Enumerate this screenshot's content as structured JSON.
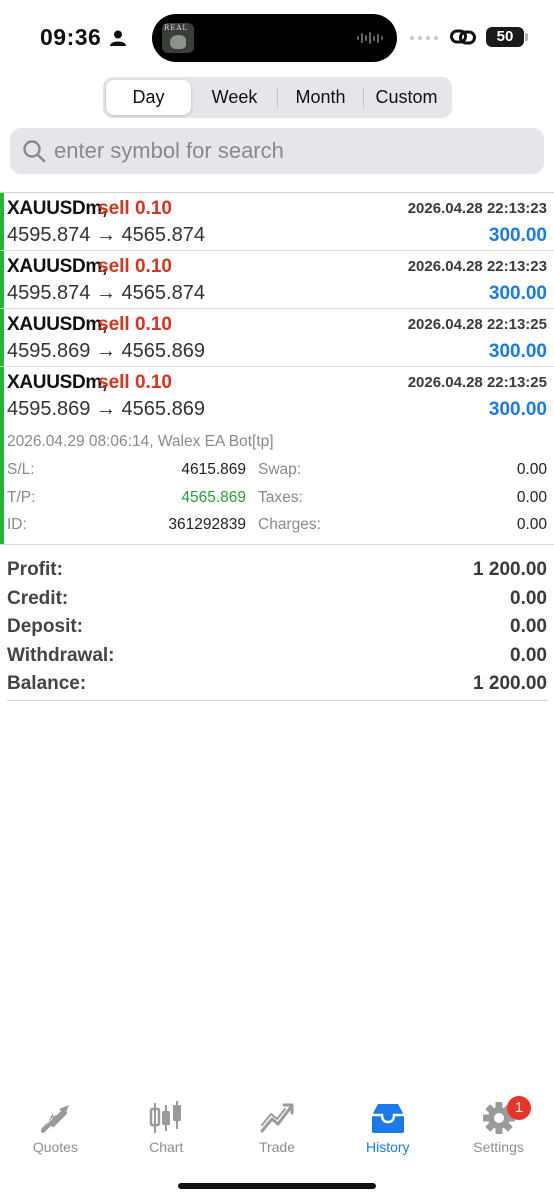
{
  "status": {
    "time": "09:36",
    "battery": "50",
    "island_thumb_text": "REAL"
  },
  "periods": {
    "items": [
      "Day",
      "Week",
      "Month",
      "Custom"
    ],
    "selected": "Day"
  },
  "search": {
    "placeholder": "enter symbol for search",
    "value": ""
  },
  "trades": [
    {
      "symbol": "XAUUSDm,",
      "side": "sell 0.10",
      "datetime": "2026.04.28 22:13:23",
      "open_price": "4595.874",
      "close_price": "4565.874",
      "arrow": "→",
      "profit": "300.00"
    },
    {
      "symbol": "XAUUSDm,",
      "side": "sell 0.10",
      "datetime": "2026.04.28 22:13:23",
      "open_price": "4595.874",
      "close_price": "4565.874",
      "arrow": "→",
      "profit": "300.00"
    },
    {
      "symbol": "XAUUSDm,",
      "side": "sell 0.10",
      "datetime": "2026.04.28 22:13:25",
      "open_price": "4595.869",
      "close_price": "4565.869",
      "arrow": "→",
      "profit": "300.00"
    },
    {
      "symbol": "XAUUSDm,",
      "side": "sell 0.10",
      "datetime": "2026.04.28 22:13:25",
      "open_price": "4595.869",
      "close_price": "4565.869",
      "arrow": "→",
      "profit": "300.00",
      "close_info": "2026.04.29 08:06:14, Walex EA Bot[tp]",
      "details": {
        "sl_label": "S/L:",
        "sl_value": "4615.869",
        "tp_label": "T/P:",
        "tp_value": "4565.869",
        "id_label": "ID:",
        "id_value": "361292839",
        "swap_label": "Swap:",
        "swap_value": "0.00",
        "taxes_label": "Taxes:",
        "taxes_value": "0.00",
        "charges_label": "Charges:",
        "charges_value": "0.00"
      }
    }
  ],
  "summary": [
    {
      "label": "Profit:",
      "value": "1 200.00"
    },
    {
      "label": "Credit:",
      "value": "0.00"
    },
    {
      "label": "Deposit:",
      "value": "0.00"
    },
    {
      "label": "Withdrawal:",
      "value": "0.00"
    },
    {
      "label": "Balance:",
      "value": "1 200.00"
    }
  ],
  "tabbar": {
    "items": [
      {
        "label": "Quotes",
        "icon": "quotes-icon"
      },
      {
        "label": "Chart",
        "icon": "chart-icon"
      },
      {
        "label": "Trade",
        "icon": "trade-icon"
      },
      {
        "label": "History",
        "icon": "history-icon",
        "active": true
      },
      {
        "label": "Settings",
        "icon": "settings-icon"
      }
    ],
    "settings_badge": "1"
  },
  "colors": {
    "accent": "#1a7ae8",
    "sell": "#d9331f",
    "profit_bar": "#26b33a",
    "tp_value": "#26a03a",
    "badge": "#e8352a"
  }
}
